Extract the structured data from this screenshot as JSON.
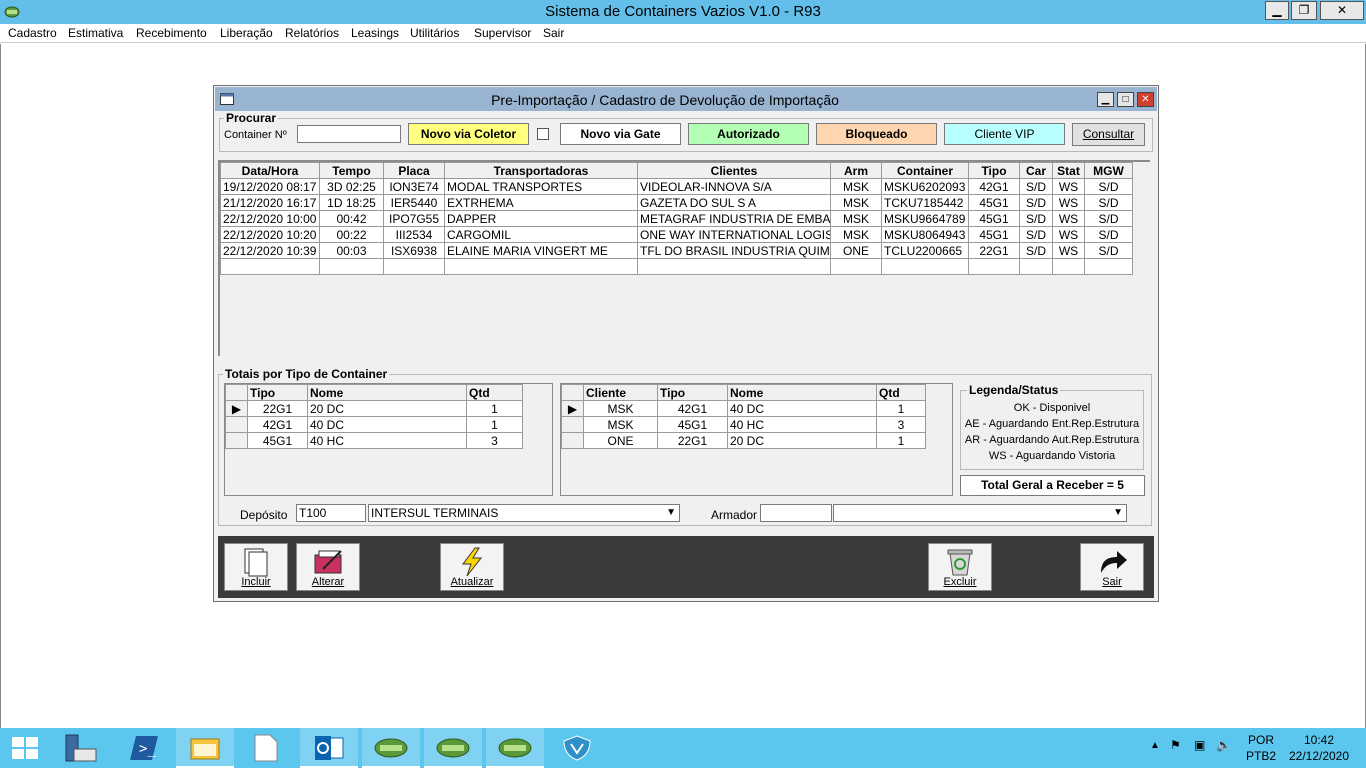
{
  "app": {
    "title": "Sistema de Containers Vazios V1.0 - R93",
    "controls": {
      "minimize": "▁",
      "restore": "❐",
      "close": "✕"
    }
  },
  "menu": [
    "Cadastro",
    "Estimativa",
    "Recebimento",
    "Liberação",
    "Relatórios",
    "Leasings",
    "Utilitários",
    "Supervisor",
    "Sair"
  ],
  "dialog": {
    "title": "Pre-Importação / Cadastro de Devolução de Importação",
    "search": {
      "group_label": "Procurar",
      "container_label": "Container Nº",
      "container_value": "",
      "btn_coletor": "Novo via Coletor",
      "btn_gate": "Novo via Gate",
      "btn_autorizado": "Autorizado",
      "btn_bloqueado": "Bloqueado",
      "btn_vip": "Cliente VIP",
      "btn_consultar": "Consultar"
    },
    "grid": {
      "headers": [
        "Data/Hora",
        "Tempo",
        "Placa",
        "Transportadoras",
        "Clientes",
        "Arm",
        "Container",
        "Tipo",
        "Car",
        "Stat",
        "MGW"
      ],
      "rows": [
        [
          "19/12/2020 08:17",
          "3D 02:25",
          "ION3E74",
          "MODAL TRANSPORTES",
          "VIDEOLAR-INNOVA S/A",
          "MSK",
          "MSKU6202093",
          "42G1",
          "S/D",
          "WS",
          "S/D"
        ],
        [
          "21/12/2020 16:17",
          "1D 18:25",
          "IER5440",
          "EXTRHEMA",
          "GAZETA DO SUL S A",
          "MSK",
          "TCKU7185442",
          "45G1",
          "S/D",
          "WS",
          "S/D"
        ],
        [
          "22/12/2020 10:00",
          "00:42",
          "IPO7G55",
          "DAPPER",
          "METAGRAF INDUSTRIA DE EMBALAGENS",
          "MSK",
          "MSKU9664789",
          "45G1",
          "S/D",
          "WS",
          "S/D"
        ],
        [
          "22/12/2020 10:20",
          "00:22",
          "III2534",
          "CARGOMIL",
          "ONE WAY INTERNATIONAL LOGISTICS",
          "MSK",
          "MSKU8064943",
          "45G1",
          "S/D",
          "WS",
          "S/D"
        ],
        [
          "22/12/2020 10:39",
          "00:03",
          "ISX6938",
          "ELAINE MARIA VINGERT ME",
          "TFL DO BRASIL INDUSTRIA QUIMICA",
          "ONE",
          "TCLU2200665",
          "22G1",
          "S/D",
          "WS",
          "S/D"
        ]
      ]
    },
    "totals": {
      "group_label": "Totais por Tipo de Container",
      "by_type": {
        "headers": [
          "Tipo",
          "Nome",
          "Qtd"
        ],
        "rows": [
          [
            "22G1",
            "20 DC",
            "1"
          ],
          [
            "42G1",
            "40 DC",
            "1"
          ],
          [
            "45G1",
            "40 HC",
            "3"
          ]
        ]
      },
      "by_client": {
        "headers": [
          "Cliente",
          "Tipo",
          "Nome",
          "Qtd"
        ],
        "rows": [
          [
            "MSK",
            "42G1",
            "40 DC",
            "1"
          ],
          [
            "MSK",
            "45G1",
            "40 HC",
            "3"
          ],
          [
            "ONE",
            "22G1",
            "20 DC",
            "1"
          ]
        ]
      },
      "legend": {
        "title": "Legenda/Status",
        "items": [
          "OK - Disponivel",
          "AE - Aguardando Ent.Rep.Estrutura",
          "AR - Aguardando Aut.Rep.Estrutura",
          "WS - Aguardando Vistoria"
        ]
      },
      "total": "Total Geral a Receber = 5"
    },
    "deposito": {
      "label": "Depósito",
      "code": "T100",
      "name": "INTERSUL TERMINAIS"
    },
    "armador": {
      "label": "Armador",
      "code": "",
      "name": ""
    },
    "toolbar": {
      "incluir": "Incluir",
      "alterar": "Alterar",
      "atualizar": "Atualizar",
      "excluir": "Excluir",
      "sair": "Sair"
    }
  },
  "taskbar": {
    "lang": "POR",
    "layout": "PTB2",
    "time": "10:42",
    "date": "22/12/2020"
  },
  "colors": {
    "title_bar": "#63bfe9",
    "dialog_title": "#99b4d1",
    "coletor": "#ffff80",
    "autorizado": "#b3ffb3",
    "bloqueado": "#ffd6b0",
    "vip": "#b8ffff",
    "taskbar": "#5bc6ee"
  }
}
